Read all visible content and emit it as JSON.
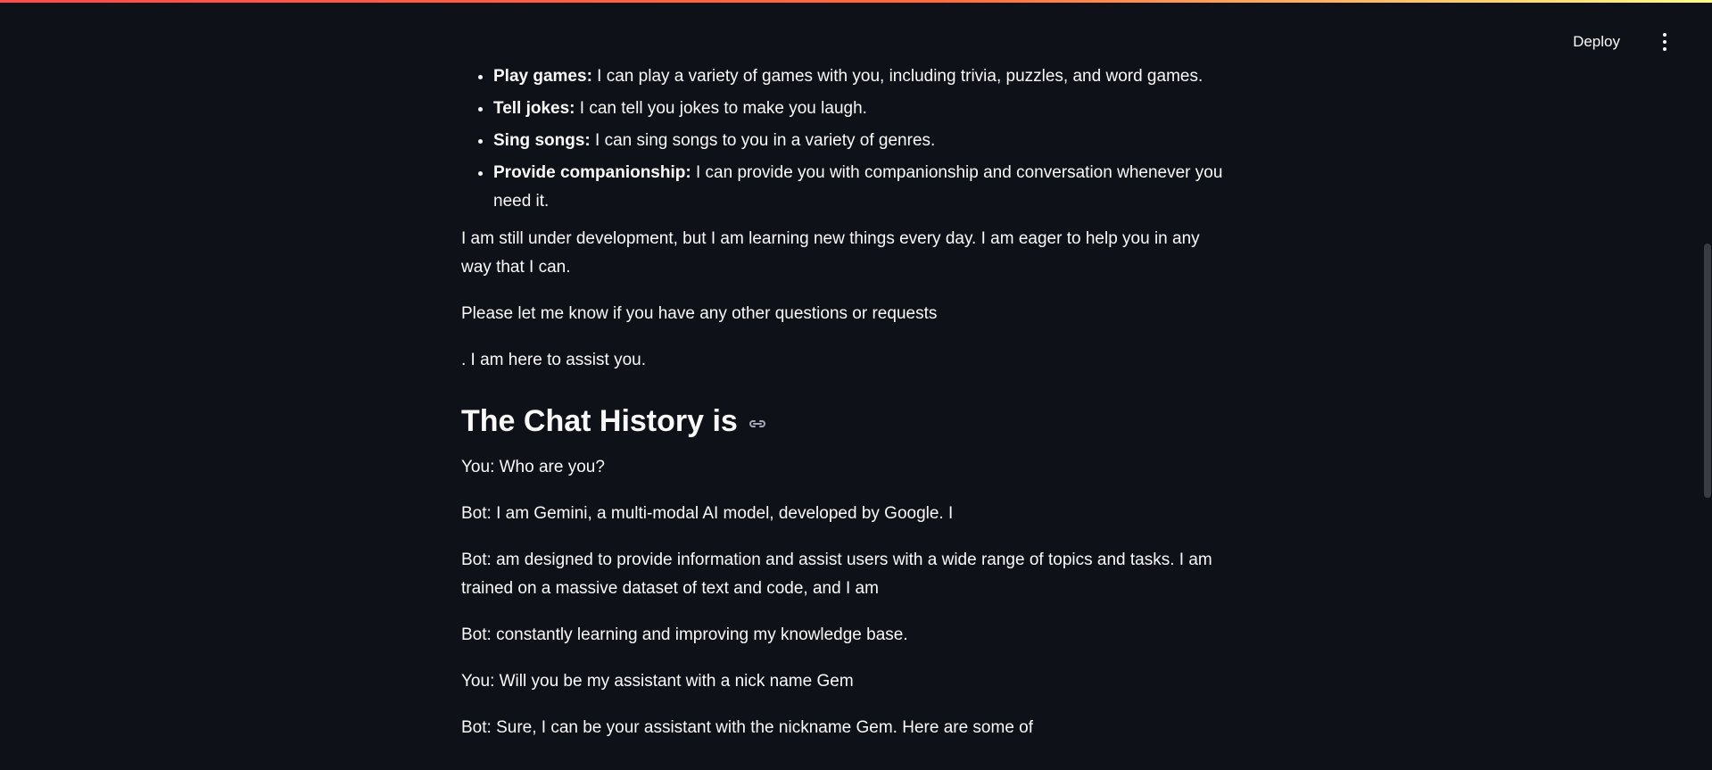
{
  "header": {
    "deploy_label": "Deploy",
    "menu_icon": "vertical-ellipsis-icon"
  },
  "colors": {
    "background": "#0e1117",
    "text": "#fafafa",
    "accent_start": "#ff4b4b",
    "accent_end": "#fffd80"
  },
  "content": {
    "list_items": [
      {
        "title": "Play games:",
        "text": " I can play a variety of games with you, including trivia, puzzles, and word games."
      },
      {
        "title": "Tell jokes:",
        "text": " I can tell you jokes to make you laugh."
      },
      {
        "title": "Sing songs:",
        "text": " I can sing songs to you in a variety of genres."
      },
      {
        "title": "Provide companionship:",
        "text": " I can provide you with companionship and conversation whenever you need it."
      }
    ],
    "paragraph_1": "I am still under development, but I am learning new things every day. I am eager to help you in any way that I can.",
    "paragraph_2": "Please let me know if you have any other questions or requests",
    "paragraph_3": ". I am here to assist you.",
    "heading": "The Chat History is",
    "heading_icon": "link-icon",
    "history": [
      "You: Who are you?",
      "Bot: I am Gemini, a multi-modal AI model, developed by Google. I",
      "Bot: am designed to provide information and assist users with a wide range of topics and tasks. I am trained on a massive dataset of text and code, and I am",
      "Bot: constantly learning and improving my knowledge base.",
      "You: Will you be my assistant with a nick name Gem",
      "Bot: Sure, I can be your assistant with the nickname Gem. Here are some of"
    ]
  }
}
